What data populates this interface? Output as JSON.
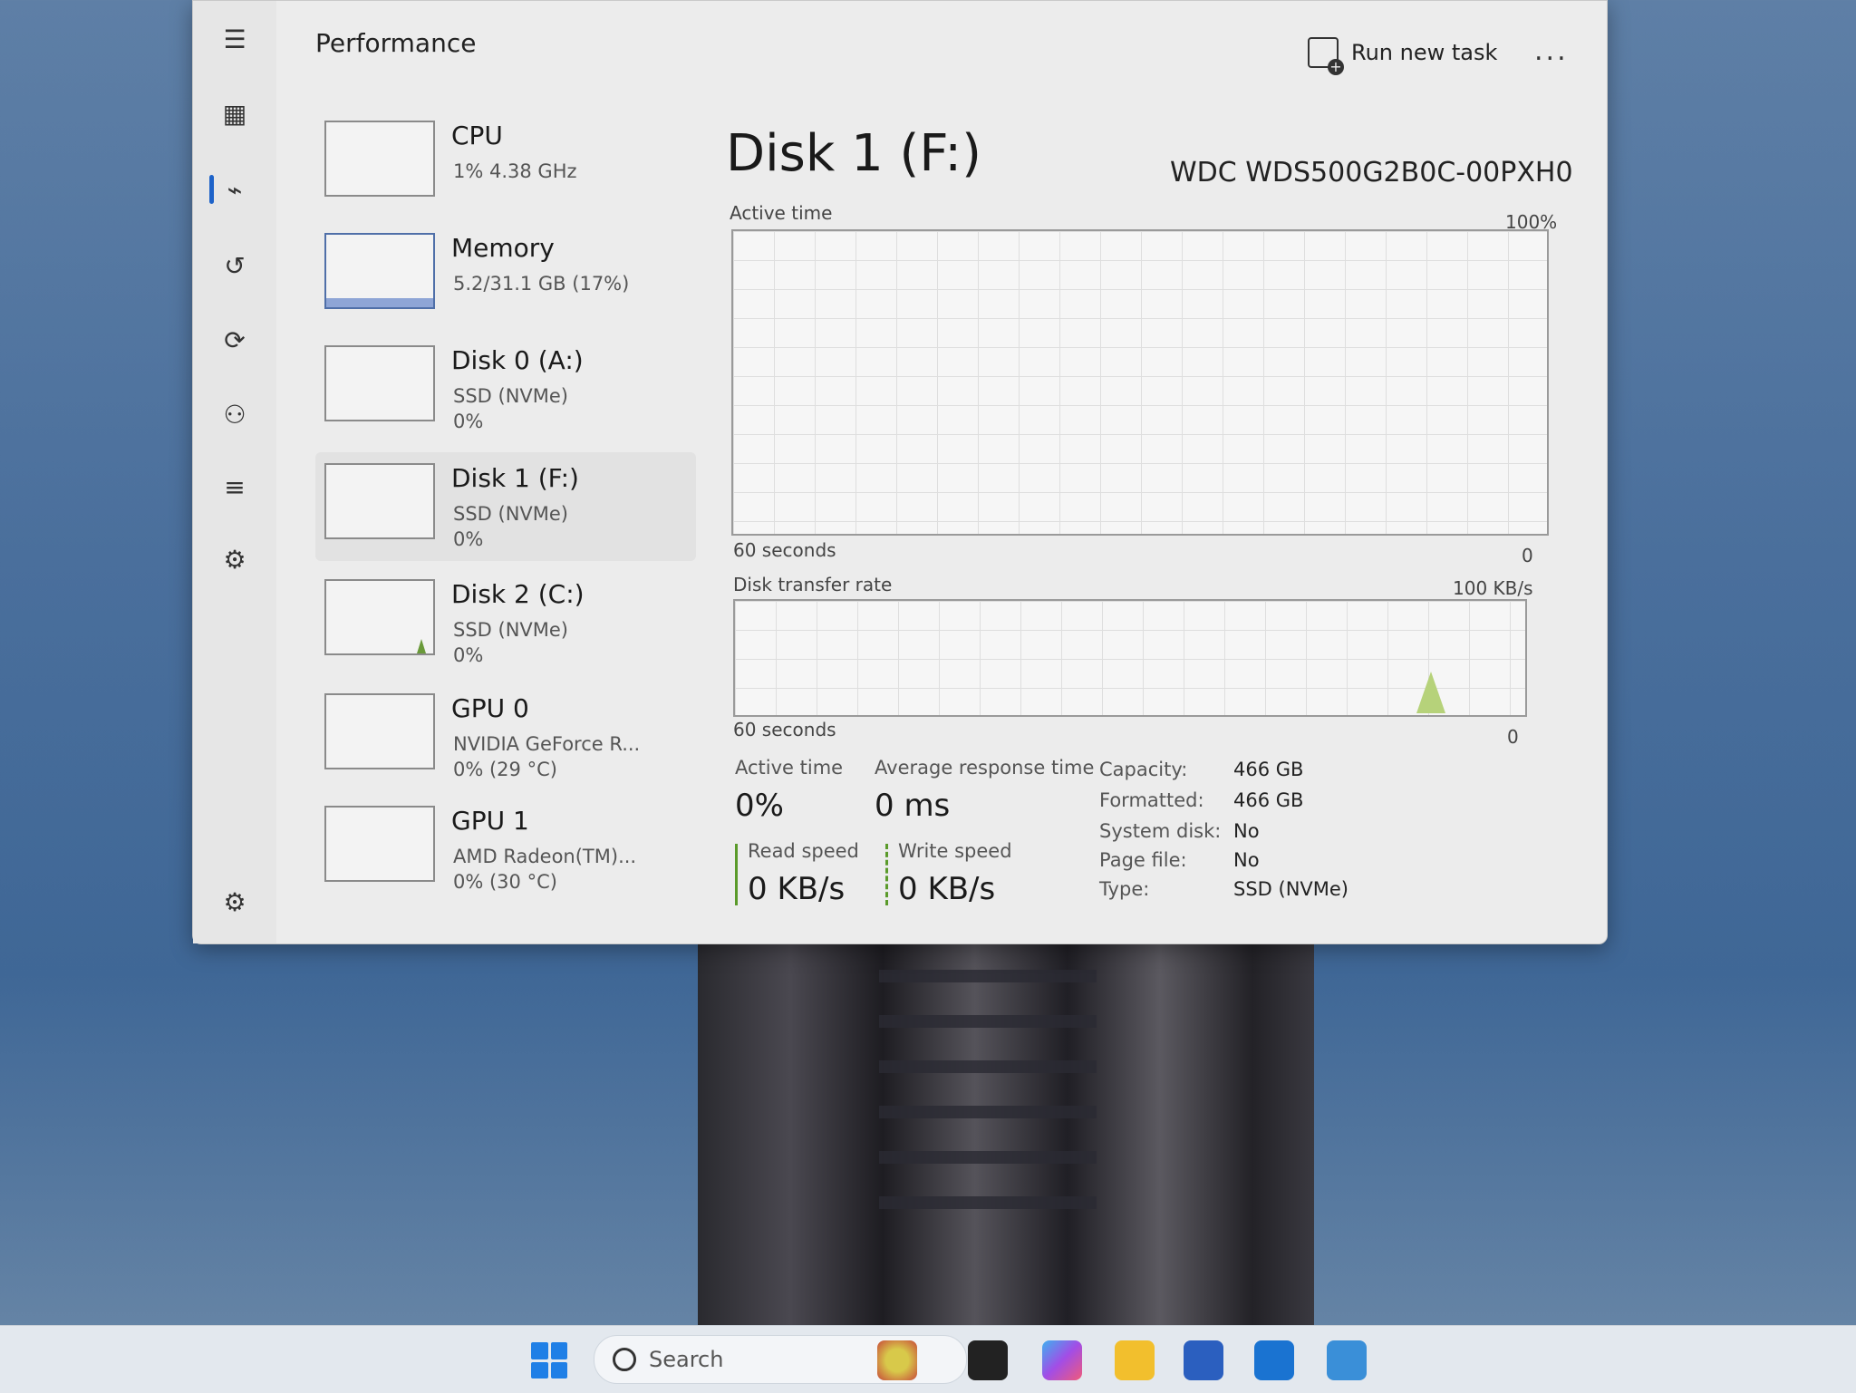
{
  "window": {
    "title": "Performance",
    "run_task_label": "Run new task",
    "more_label": "..."
  },
  "sidebar": [
    {
      "name": "CPU",
      "line1": "1%  4.38 GHz",
      "line2": "",
      "line3": ""
    },
    {
      "name": "Memory",
      "line1": "5.2/31.1 GB (17%)",
      "line2": "",
      "line3": ""
    },
    {
      "name": "Disk 0 (A:)",
      "line1": "SSD (NVMe)",
      "line2": "0%",
      "line3": ""
    },
    {
      "name": "Disk 1 (F:)",
      "line1": "SSD (NVMe)",
      "line2": "0%",
      "line3": ""
    },
    {
      "name": "Disk 2 (C:)",
      "line1": "SSD (NVMe)",
      "line2": "0%",
      "line3": ""
    },
    {
      "name": "GPU 0",
      "line1": "NVIDIA GeForce R...",
      "line2": "0%  (29 °C)",
      "line3": ""
    },
    {
      "name": "GPU 1",
      "line1": "AMD Radeon(TM)...",
      "line2": "0%  (30 °C)",
      "line3": ""
    }
  ],
  "detail": {
    "title": "Disk 1 (F:)",
    "model": "WDC WDS500G2B0C-00PXH0",
    "active_time_label": "Active time",
    "active_time_max": "100%",
    "active_time_seconds": "60 seconds",
    "active_time_min": "0",
    "transfer_label": "Disk transfer rate",
    "transfer_max": "100 KB/s",
    "transfer_seconds": "60 seconds",
    "transfer_min": "0"
  },
  "stats": {
    "active_time_label": "Active time",
    "active_time_value": "0%",
    "avg_response_label": "Average response time",
    "avg_response_value": "0 ms",
    "read_label": "Read speed",
    "read_value": "0 KB/s",
    "write_label": "Write speed",
    "write_value": "0 KB/s"
  },
  "properties": [
    {
      "key": "Capacity:",
      "value": "466 GB"
    },
    {
      "key": "Formatted:",
      "value": "466 GB"
    },
    {
      "key": "System disk:",
      "value": "No"
    },
    {
      "key": "Page file:",
      "value": "No"
    },
    {
      "key": "Type:",
      "value": "SSD (NVMe)"
    }
  ],
  "taskbar": {
    "search_placeholder": "Search"
  },
  "colors": {
    "accent": "#1e63c9",
    "disk_graph_green": "#5a9a2a"
  }
}
